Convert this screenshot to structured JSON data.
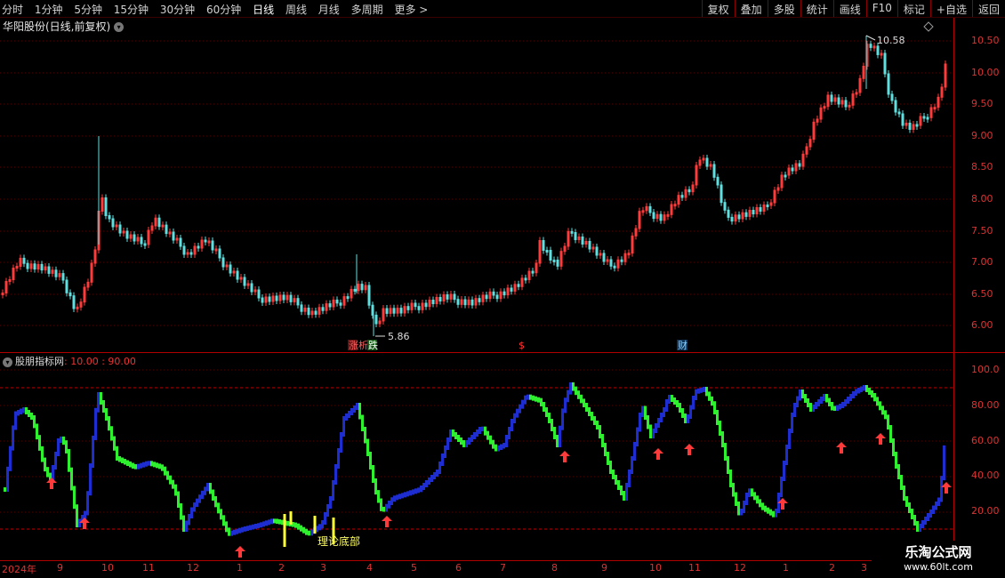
{
  "toolbar": {
    "periods": [
      "分时",
      "1分钟",
      "5分钟",
      "15分钟",
      "30分钟",
      "60分钟",
      "日线",
      "周线",
      "月线",
      "多周期",
      "更多 >"
    ],
    "active_period": "日线",
    "actions": [
      "复权",
      "叠加",
      "多股",
      "统计",
      "画线",
      "F10",
      "标记",
      "+自选",
      "返回"
    ]
  },
  "stock": {
    "title": "华阳股份(日线,前复权)",
    "price_axis_labels": [
      "10.50",
      "10.00",
      "9.50",
      "9.00",
      "8.50",
      "8.00",
      "7.50",
      "7.00",
      "6.50",
      "6.00"
    ],
    "high_label": "10.58",
    "low_label": "5.86",
    "event_tags": [
      "涨",
      "析",
      "跌",
      "$",
      "财"
    ]
  },
  "indicator": {
    "name": "股朋指标网",
    "params": ": 10.00 : 90.00",
    "axis_labels": [
      "100.0",
      "80.00",
      "60.00",
      "40.00",
      "20.00"
    ],
    "annotation": "理论底部"
  },
  "x_axis": [
    "2024年",
    "9",
    "10",
    "11",
    "12",
    "1",
    "2",
    "3",
    "4",
    "5",
    "6",
    "7",
    "8",
    "9",
    "10",
    "11",
    "12",
    "1",
    "2",
    "3"
  ],
  "watermark": {
    "line1": "乐淘公式网",
    "line2": "www.60lt.com"
  },
  "colors": {
    "up": "#ff3a3a",
    "down": "#5fe0e0",
    "blue": "#1e2dd0",
    "green": "#2ef02e",
    "yellow": "#ffff33"
  }
}
